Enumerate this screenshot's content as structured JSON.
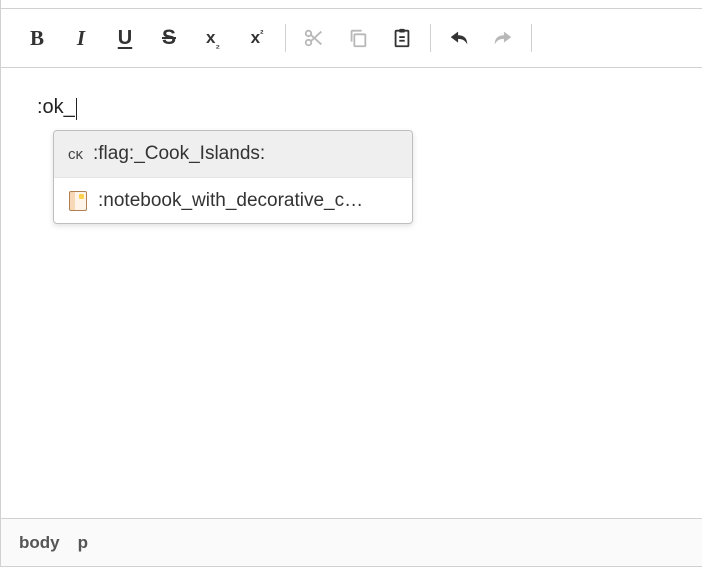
{
  "toolbar": {
    "bold_glyph": "B",
    "italic_glyph": "I",
    "underline_glyph": "U",
    "strike_glyph": "S",
    "subscript_base": "x",
    "subscript_small": "₂",
    "superscript_base": "x",
    "superscript_small": "²"
  },
  "content": {
    "typed": ":ok_"
  },
  "autocomplete": {
    "items": [
      {
        "icon_text": "cĸ",
        "label": ":flag:_Cook_Islands:",
        "selected": true
      },
      {
        "icon_text": "",
        "label": ":notebook_with_decorative_c…",
        "selected": false
      }
    ]
  },
  "status": {
    "path": [
      "body",
      "p"
    ]
  }
}
